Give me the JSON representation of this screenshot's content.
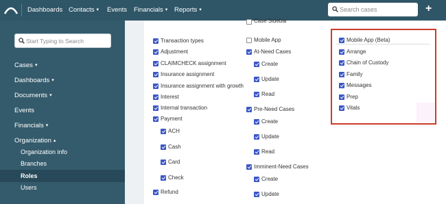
{
  "topnav": {
    "logo_icon": "arch-logo-icon",
    "items": [
      {
        "label": "Dashboards",
        "caret": ""
      },
      {
        "label": "Contacts",
        "caret": "▾"
      },
      {
        "label": "Events",
        "caret": ""
      },
      {
        "label": "Financials",
        "caret": "▾"
      },
      {
        "label": "Reports",
        "caret": "▾"
      }
    ],
    "search_placeholder": "Search cases",
    "add_label": "+"
  },
  "sidebar": {
    "search_placeholder": "Start Typing to Search",
    "items": [
      {
        "label": "Cases",
        "caret": "▾"
      },
      {
        "label": "Dashboards",
        "caret": "▾"
      },
      {
        "label": "Documents",
        "caret": "▾"
      },
      {
        "label": "Events",
        "caret": ""
      },
      {
        "label": "Financials",
        "caret": "▾"
      },
      {
        "label": "Organization",
        "caret": "▴"
      }
    ],
    "subitems": [
      {
        "label": "Organization info"
      },
      {
        "label": "Branches"
      },
      {
        "label": "Roles"
      },
      {
        "label": "Users"
      }
    ]
  },
  "permissions": {
    "col1": [
      {
        "label": "Transaction types",
        "checked": true
      },
      {
        "label": "Adjustment",
        "checked": true
      },
      {
        "label": "CLAIMCHECK assignment",
        "checked": true
      },
      {
        "label": "Insurance assignment",
        "checked": true
      },
      {
        "label": "Insurance assignment with growth",
        "checked": true
      },
      {
        "label": "Interest",
        "checked": true
      },
      {
        "label": "Internal transaction",
        "checked": true
      },
      {
        "label": "Payment",
        "checked": true
      },
      {
        "label": "ACH",
        "checked": true
      },
      {
        "label": "Cash",
        "checked": true
      },
      {
        "label": "Card",
        "checked": true
      },
      {
        "label": "Check",
        "checked": true
      },
      {
        "label": "Refund",
        "checked": true
      }
    ],
    "col2": [
      {
        "label": "Case Sidebar",
        "checked": false
      },
      {
        "label": "Mobile App",
        "checked": false
      },
      {
        "label": "At-Need Cases",
        "checked": true
      },
      {
        "label": "Create",
        "checked": true
      },
      {
        "label": "Update",
        "checked": true
      },
      {
        "label": "Read",
        "checked": true
      },
      {
        "label": "Pre-Need Cases",
        "checked": true
      },
      {
        "label": "Create",
        "checked": true
      },
      {
        "label": "Update",
        "checked": true
      },
      {
        "label": "Read",
        "checked": true
      },
      {
        "label": "Imminent-Need Cases",
        "checked": true
      },
      {
        "label": "Create",
        "checked": true
      },
      {
        "label": "Update",
        "checked": true
      }
    ],
    "col3": [
      {
        "label": "Mobile App (Beta)",
        "checked": true
      },
      {
        "label": "Arrange",
        "checked": true
      },
      {
        "label": "Chain of Custody",
        "checked": true
      },
      {
        "label": "Family",
        "checked": true
      },
      {
        "label": "Messages",
        "checked": true
      },
      {
        "label": "Prep",
        "checked": true
      },
      {
        "label": "Vitals",
        "checked": true
      }
    ]
  },
  "colors": {
    "topbar": "#2f5667",
    "sidebar": "#345b6c",
    "checkbox": "#3c57c6",
    "highlight_border": "#c93a2c"
  }
}
